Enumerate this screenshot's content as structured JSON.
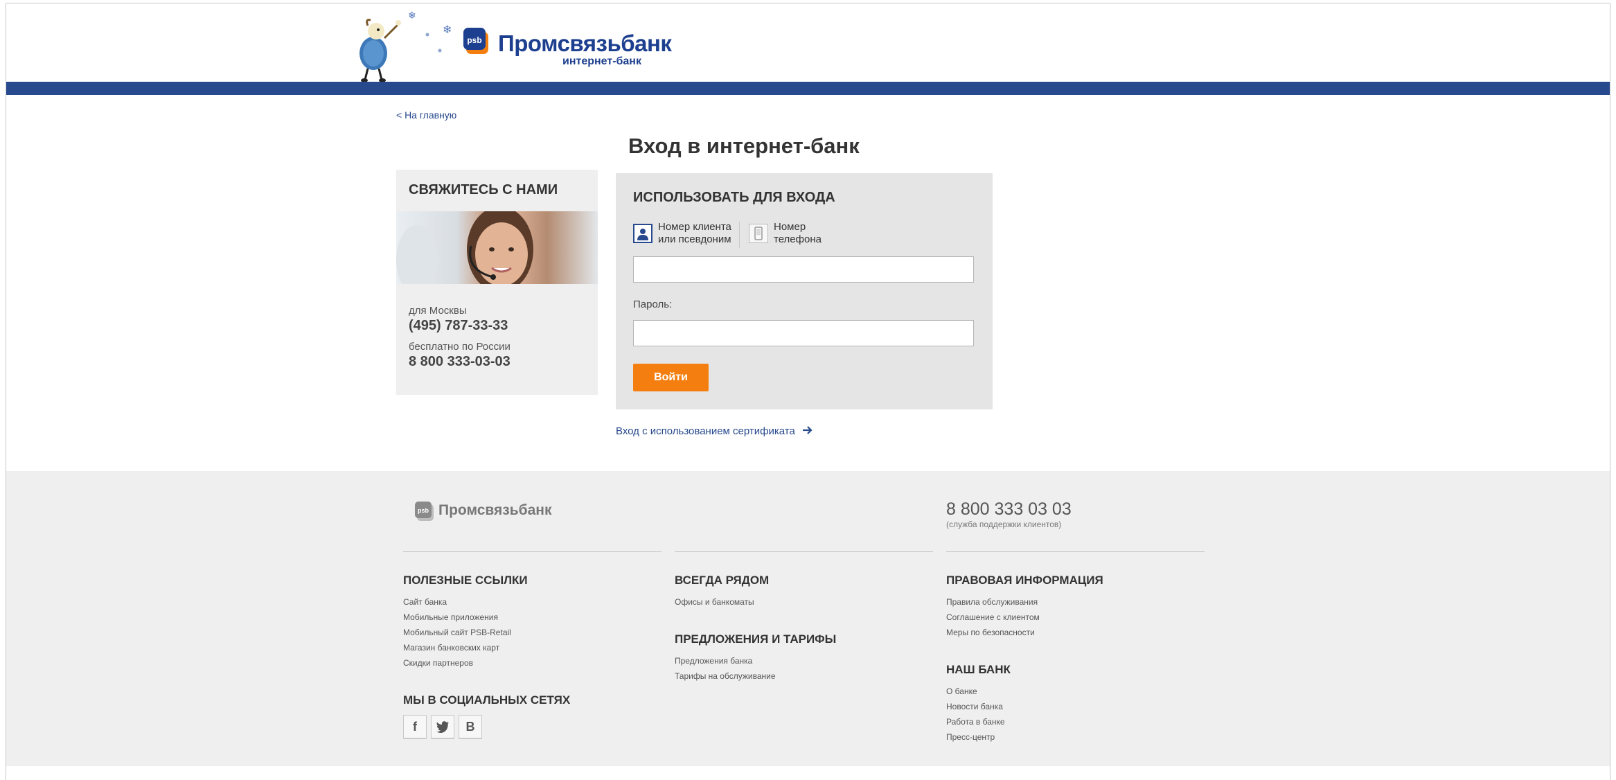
{
  "header": {
    "bank_name": "Промсвязьбанк",
    "bank_sub": "интернет-банк",
    "logo_mark_text": "psb",
    "brand_blue": "#27498d",
    "brand_orange": "#f47f10"
  },
  "nav": {
    "back_label": "< На главную"
  },
  "page": {
    "title": "Вход в интернет-банк"
  },
  "contact": {
    "heading": "СВЯЖИТЕСЬ С НАМИ",
    "moscow_label": "для Москвы",
    "moscow_phone": "(495) 787-33-33",
    "russia_label": "бесплатно по России",
    "russia_phone": "8 800 333-03-03"
  },
  "login": {
    "heading": "ИСПОЛЬЗОВАТЬ ДЛЯ ВХОДА",
    "modes": [
      {
        "label_line1": "Номер клиента",
        "label_line2": "или псевдоним",
        "icon": "user-icon",
        "selected": true
      },
      {
        "label_line1": "Номер",
        "label_line2": "телефона",
        "icon": "phone-icon",
        "selected": false
      }
    ],
    "login_value": "",
    "password_label": "Пароль:",
    "password_value": "",
    "submit_label": "Войти",
    "cert_link": "Вход с использованием сертификата"
  },
  "footer": {
    "bank_name": "Промсвязьбанк",
    "phone": "8 800 333 03 03",
    "phone_note": "(служба поддержки клиентов)",
    "useful_links": {
      "heading": "ПОЛЕЗНЫЕ ССЫЛКИ",
      "items": [
        "Сайт банка",
        "Мобильные приложения",
        "Мобильный сайт PSB-Retail",
        "Магазин банковских карт",
        "Скидки партнеров"
      ]
    },
    "social": {
      "heading": "МЫ В СОЦИАЛЬНЫХ СЕТЯХ",
      "items": [
        {
          "glyph": "f",
          "icon": "facebook-icon"
        },
        {
          "glyph": "t",
          "icon": "twitter-icon"
        },
        {
          "glyph": "В",
          "icon": "vkontakte-icon"
        }
      ]
    },
    "always_near": {
      "heading": "ВСЕГДА РЯДОМ",
      "items": [
        "Офисы и банкоматы"
      ]
    },
    "offers": {
      "heading": "ПРЕДЛОЖЕНИЯ И ТАРИФЫ",
      "items": [
        "Предложения банка",
        "Тарифы на обслуживание"
      ]
    },
    "legal": {
      "heading": "ПРАВОВАЯ ИНФОРМАЦИЯ",
      "items": [
        "Правила обслуживания",
        "Соглашение с клиентом",
        "Меры по безопасности"
      ]
    },
    "our_bank": {
      "heading": "НАШ БАНК",
      "items": [
        "О банке",
        "Новости банка",
        "Работа в банке",
        "Пресс-центр"
      ]
    }
  }
}
